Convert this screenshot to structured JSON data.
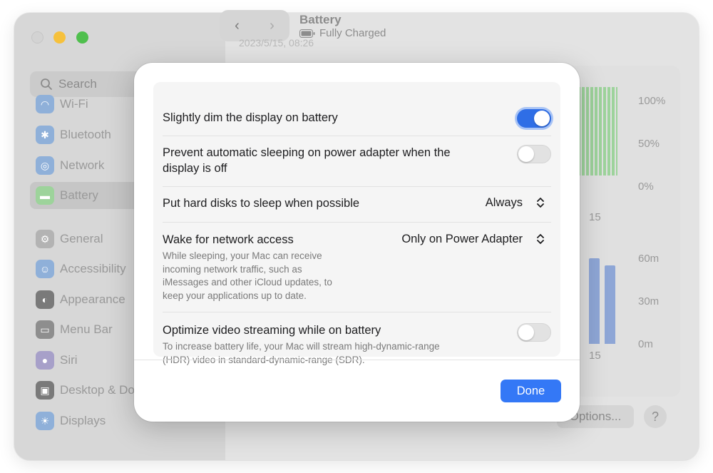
{
  "window": {
    "title": "Battery",
    "subtitle": "Fully Charged",
    "date": "2023/5/15, 08:26"
  },
  "sidebar": {
    "search_placeholder": "Search",
    "items": [
      {
        "label": "Wi-Fi",
        "icon": "wifi-icon",
        "color": "#8fb0d9"
      },
      {
        "label": "Bluetooth",
        "icon": "bluetooth-icon",
        "color": "#8fb0d9"
      },
      {
        "label": "Network",
        "icon": "network-icon",
        "color": "#8fb0d9"
      },
      {
        "label": "Battery",
        "icon": "battery-icon",
        "color": "#9dd39b",
        "selected": true
      },
      {
        "label": "General",
        "icon": "gear-icon",
        "color": "#b3b3b3"
      },
      {
        "label": "Accessibility",
        "icon": "accessibility-icon",
        "color": "#8fb0d9"
      },
      {
        "label": "Appearance",
        "icon": "appearance-icon",
        "color": "#7a7a7a"
      },
      {
        "label": "Menu Bar",
        "icon": "menubar-icon",
        "color": "#8e8e8e"
      },
      {
        "label": "Siri",
        "icon": "siri-icon",
        "color": "#a7a0c9"
      },
      {
        "label": "Desktop & Dock",
        "icon": "dock-icon",
        "color": "#7a7a7a"
      },
      {
        "label": "Displays",
        "icon": "displays-icon",
        "color": "#8fb0d9"
      }
    ]
  },
  "charts": {
    "level_labels": [
      "100%",
      "50%",
      "0%"
    ],
    "usage_labels": [
      "60m",
      "30m",
      "0m"
    ],
    "x_tick": "15"
  },
  "footer": {
    "options_label": "Options...",
    "help_label": "?"
  },
  "sheet": {
    "dim_display": {
      "label": "Slightly dim the display on battery",
      "on": true
    },
    "prevent_sleep": {
      "label_line1": "Prevent automatic sleeping on power adapter when the",
      "label_line2": "display is off",
      "on": false
    },
    "hard_disks": {
      "label": "Put hard disks to sleep when possible",
      "value": "Always"
    },
    "wake_network": {
      "label": "Wake for network access",
      "value": "Only on Power Adapter",
      "desc_lines": [
        "While sleeping, your Mac can receive",
        "incoming network traffic, such as",
        "iMessages and other iCloud updates, to",
        "keep your applications up to date."
      ]
    },
    "video_streaming": {
      "label": "Optimize video streaming while on battery",
      "on": false,
      "desc_lines": [
        "To increase battery life, your Mac will stream high-dynamic-range",
        "(HDR) video in standard-dynamic-range (SDR)."
      ]
    },
    "done_label": "Done"
  },
  "colors": {
    "accent": "#3478f6",
    "toggle_on": "#2f6ee6",
    "chart_green": "#9dd39b",
    "chart_blue": "#8ea6d6"
  }
}
